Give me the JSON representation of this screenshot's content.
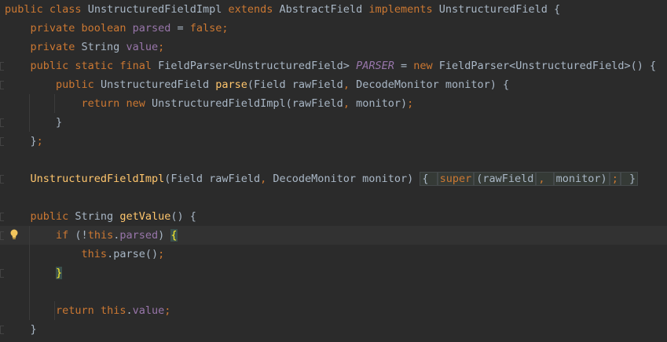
{
  "editor": {
    "lines": [
      {
        "tokens": [
          {
            "t": "public ",
            "c": "kw"
          },
          {
            "t": "class ",
            "c": "kw"
          },
          {
            "t": "UnstructuredFieldImpl ",
            "c": ""
          },
          {
            "t": "extends ",
            "c": "kw"
          },
          {
            "t": "AbstractField ",
            "c": ""
          },
          {
            "t": "implements ",
            "c": "kw"
          },
          {
            "t": "UnstructuredField {",
            "c": ""
          }
        ]
      },
      {
        "tokens": [
          {
            "t": "    ",
            "c": ""
          },
          {
            "t": "private ",
            "c": "kw"
          },
          {
            "t": "boolean ",
            "c": "kw"
          },
          {
            "t": "parsed",
            "c": "fld"
          },
          {
            "t": " = ",
            "c": ""
          },
          {
            "t": "false",
            "c": "kw"
          },
          {
            "t": ";",
            "c": "kw"
          }
        ]
      },
      {
        "tokens": [
          {
            "t": "    ",
            "c": ""
          },
          {
            "t": "private ",
            "c": "kw"
          },
          {
            "t": "String ",
            "c": ""
          },
          {
            "t": "value",
            "c": "fld"
          },
          {
            "t": ";",
            "c": "kw"
          }
        ]
      },
      {
        "tokens": [
          {
            "t": "    ",
            "c": ""
          },
          {
            "t": "public ",
            "c": "kw"
          },
          {
            "t": "static ",
            "c": "kw"
          },
          {
            "t": "final ",
            "c": "kw"
          },
          {
            "t": "FieldParser<UnstructuredField> ",
            "c": ""
          },
          {
            "t": "PARSER",
            "c": "con"
          },
          {
            "t": " = ",
            "c": ""
          },
          {
            "t": "new ",
            "c": "kw"
          },
          {
            "t": "FieldParser<UnstructuredField>() {",
            "c": ""
          }
        ]
      },
      {
        "tokens": [
          {
            "t": "        ",
            "c": ""
          },
          {
            "t": "public ",
            "c": "kw"
          },
          {
            "t": "UnstructuredField ",
            "c": ""
          },
          {
            "t": "parse",
            "c": "mth"
          },
          {
            "t": "(Field rawField",
            "c": ""
          },
          {
            "t": ", ",
            "c": "kw"
          },
          {
            "t": "DecodeMonitor monitor) {",
            "c": ""
          }
        ]
      },
      {
        "tokens": [
          {
            "t": "            ",
            "c": ""
          },
          {
            "t": "return ",
            "c": "kw"
          },
          {
            "t": "new ",
            "c": "kw"
          },
          {
            "t": "UnstructuredFieldImpl(rawField",
            "c": ""
          },
          {
            "t": ", ",
            "c": "kw"
          },
          {
            "t": "monitor)",
            "c": ""
          },
          {
            "t": ";",
            "c": "kw"
          }
        ]
      },
      {
        "tokens": [
          {
            "t": "        }",
            "c": ""
          }
        ]
      },
      {
        "tokens": [
          {
            "t": "    }",
            "c": ""
          },
          {
            "t": ";",
            "c": "kw"
          }
        ]
      },
      {
        "tokens": []
      },
      {
        "tokens": [
          {
            "t": "    ",
            "c": ""
          },
          {
            "t": "UnstructuredFieldImpl",
            "c": "mth"
          },
          {
            "t": "(Field rawField",
            "c": ""
          },
          {
            "t": ", ",
            "c": "kw"
          },
          {
            "t": "DecodeMonitor monitor) ",
            "c": ""
          },
          {
            "t": "{ ",
            "c": "fold-region"
          },
          {
            "t": "super",
            "c": "kw fold-region"
          },
          {
            "t": "(rawField",
            "c": "fold-region"
          },
          {
            "t": ", ",
            "c": "kw fold-region"
          },
          {
            "t": "monitor)",
            "c": "fold-region"
          },
          {
            "t": ";",
            "c": "kw fold-region"
          },
          {
            "t": " }",
            "c": "fold-region"
          }
        ]
      },
      {
        "tokens": []
      },
      {
        "tokens": [
          {
            "t": "    ",
            "c": ""
          },
          {
            "t": "public ",
            "c": "kw"
          },
          {
            "t": "String ",
            "c": ""
          },
          {
            "t": "getValue",
            "c": "mth"
          },
          {
            "t": "() {",
            "c": ""
          }
        ]
      },
      {
        "tokens": [
          {
            "t": "        ",
            "c": ""
          },
          {
            "t": "if ",
            "c": "kw"
          },
          {
            "t": "(!",
            "c": ""
          },
          {
            "t": "this",
            "c": "kw"
          },
          {
            "t": ".",
            "c": ""
          },
          {
            "t": "parsed",
            "c": "fld"
          },
          {
            "t": ") ",
            "c": ""
          },
          {
            "t": "{",
            "c": "brace-hl"
          }
        ]
      },
      {
        "tokens": [
          {
            "t": "            ",
            "c": ""
          },
          {
            "t": "this",
            "c": "kw"
          },
          {
            "t": ".parse()",
            "c": ""
          },
          {
            "t": ";",
            "c": "kw"
          }
        ]
      },
      {
        "tokens": [
          {
            "t": "        ",
            "c": ""
          },
          {
            "t": "}",
            "c": "brace-hl"
          }
        ]
      },
      {
        "tokens": []
      },
      {
        "tokens": [
          {
            "t": "        ",
            "c": ""
          },
          {
            "t": "return ",
            "c": "kw"
          },
          {
            "t": "this",
            "c": "kw"
          },
          {
            "t": ".",
            "c": ""
          },
          {
            "t": "value",
            "c": "fld"
          },
          {
            "t": ";",
            "c": "kw"
          }
        ]
      },
      {
        "tokens": [
          {
            "t": "    }",
            "c": ""
          }
        ]
      }
    ],
    "current_line": 12,
    "fold_markers": [
      3,
      4,
      6,
      7,
      9,
      11,
      12,
      14,
      17
    ],
    "bulb_line": 12,
    "icons": {
      "bulb": "lightbulb-icon",
      "fold": "fold-marker-icon"
    },
    "colors": {
      "background": "#2b2b2b",
      "keyword": "#cc7832",
      "field": "#9876aa",
      "method": "#ffc66d",
      "text": "#a9b7c6"
    }
  }
}
